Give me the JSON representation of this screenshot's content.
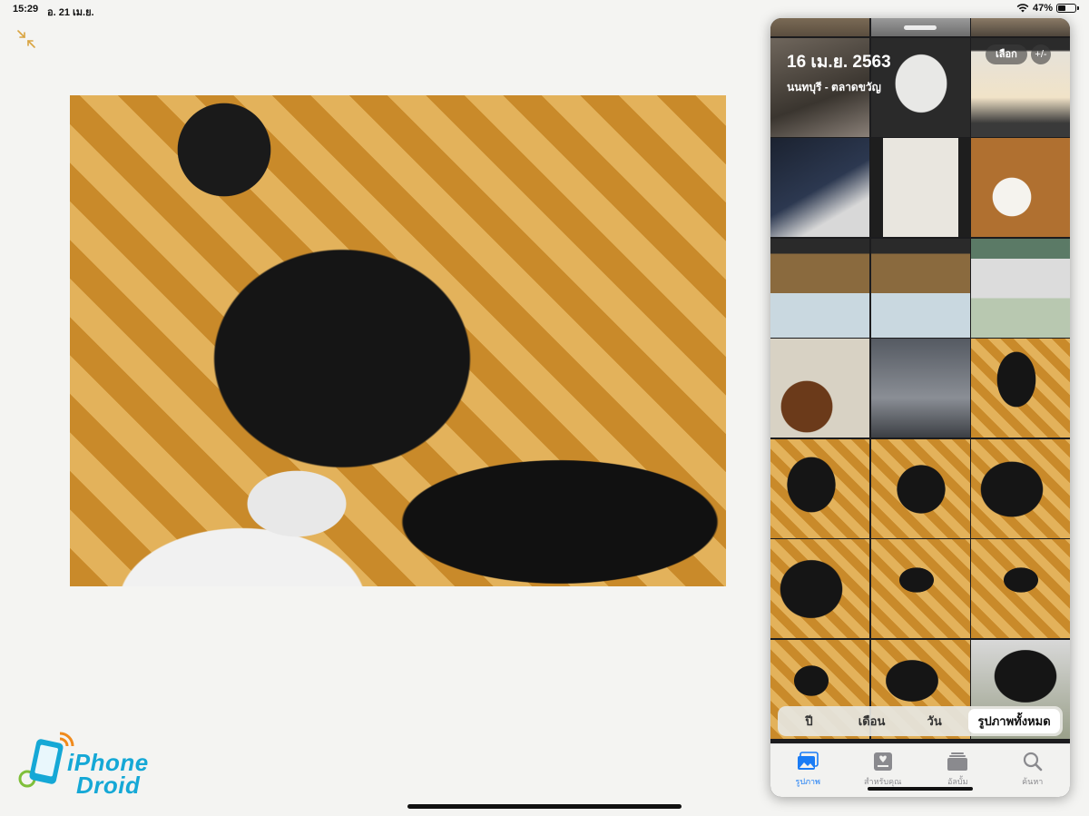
{
  "status_bar": {
    "time": "15:29",
    "date": "อ. 21 เม.ย.",
    "battery": "47%",
    "battery_level": 0.47
  },
  "main_photo": {
    "subject": "cat-photo"
  },
  "watermark": {
    "line1": "iPhone",
    "line2": "Droid"
  },
  "photos_panel": {
    "header": {
      "date": "16 เม.ย. 2563",
      "place": "นนทบุรี - ตลาดขวัญ"
    },
    "select_label": "เลือก",
    "zoom_label": "+/-",
    "segments": [
      {
        "label": "ปี",
        "active": false
      },
      {
        "label": "เดือน",
        "active": false
      },
      {
        "label": "วัน",
        "active": false
      },
      {
        "label": "รูปภาพทั้งหมด",
        "active": true
      }
    ],
    "tabs": [
      {
        "label": "รูปภาพ",
        "icon": "photos-icon",
        "active": true
      },
      {
        "label": "สำหรับคุณ",
        "icon": "for-you-icon",
        "active": false
      },
      {
        "label": "อัลบั้ม",
        "icon": "albums-icon",
        "active": false
      },
      {
        "label": "ค้นหา",
        "icon": "search-icon",
        "active": false
      }
    ]
  },
  "colors": {
    "accent": "#1a7cf5",
    "logo_blue": "#15a8d6",
    "logo_orange": "#f08a1c",
    "minimize_icon": "#d9a441"
  }
}
